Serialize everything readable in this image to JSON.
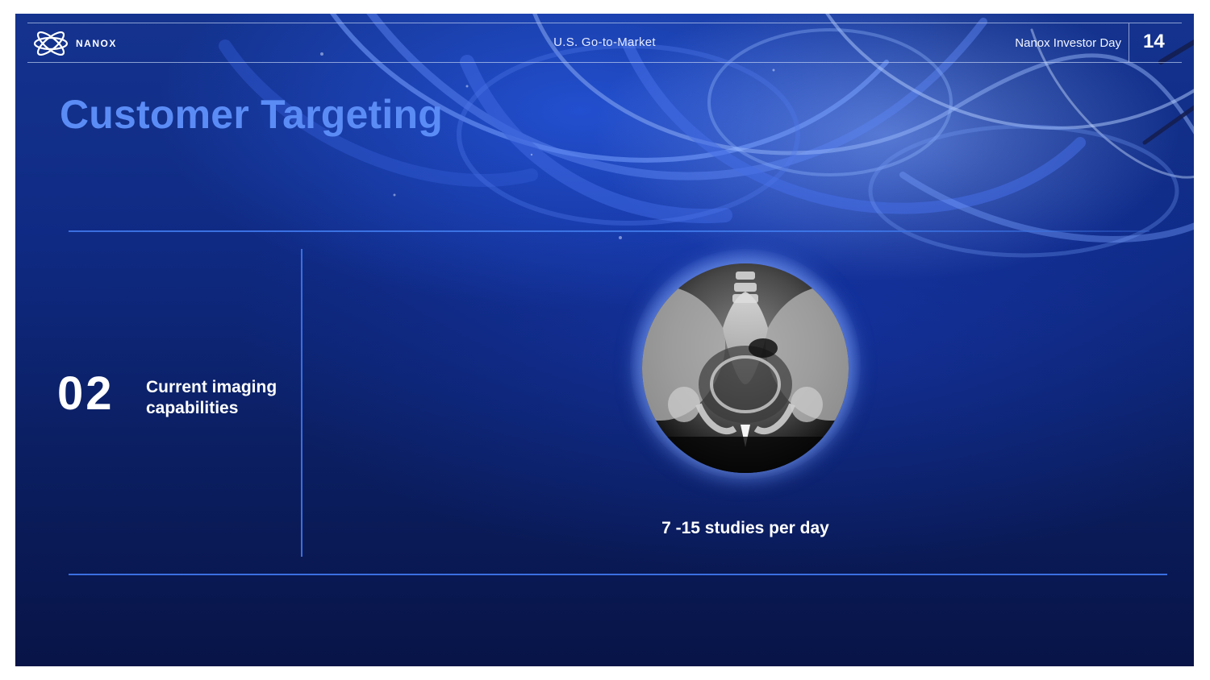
{
  "header": {
    "logo_text": "NANOX",
    "section": "U.S. Go-to-Market",
    "event": "Nanox Investor Day",
    "page_number": "14"
  },
  "title": "Customer Targeting",
  "item": {
    "number": "02",
    "caption_line1": "Current imaging",
    "caption_line2": "capabilities"
  },
  "image": {
    "icon": "pelvis-xray-image"
  },
  "metric": "7 -15 studies per day",
  "colors": {
    "title": "#5b8cf6",
    "accent_line": "#3a6fe0",
    "background_dark": "#081447"
  }
}
